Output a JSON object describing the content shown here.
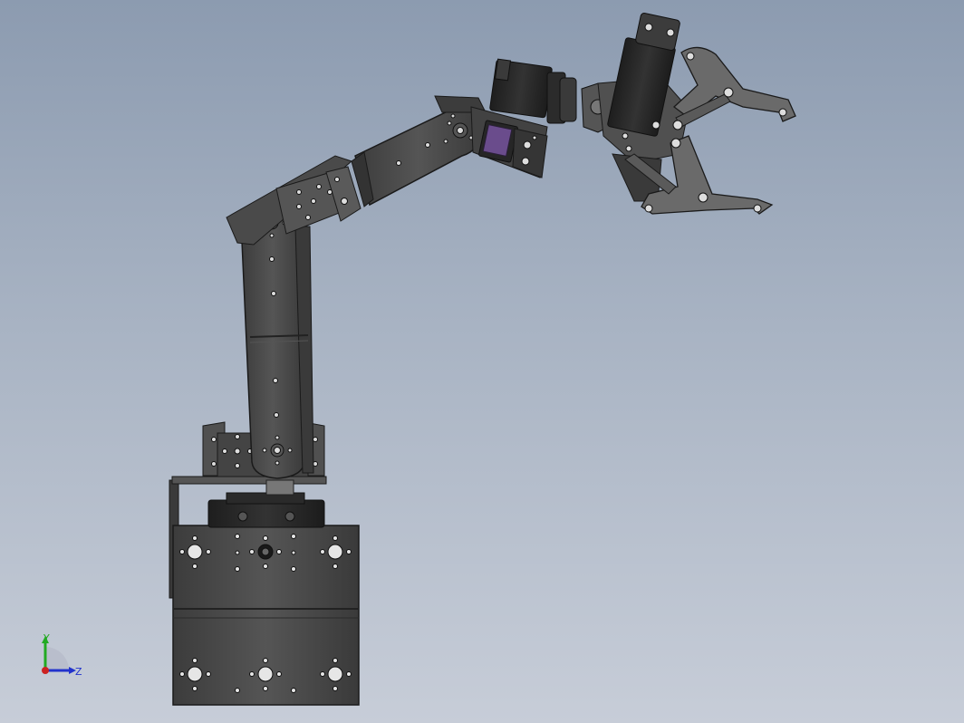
{
  "viewport": {
    "background_top": "#8c9bb0",
    "background_bottom": "#c7cdd8"
  },
  "model": {
    "metal_color": "#4a4a4a",
    "metal_dark": "#2e2e2e",
    "servo_color": "#262626",
    "label_color": "#6a4c8c",
    "edge_color": "#1a1a1a"
  },
  "triad": {
    "y_label": "Y",
    "z_label": "Z",
    "y_color": "#22aa22",
    "z_color": "#2233cc",
    "origin_color": "#cc2222"
  }
}
